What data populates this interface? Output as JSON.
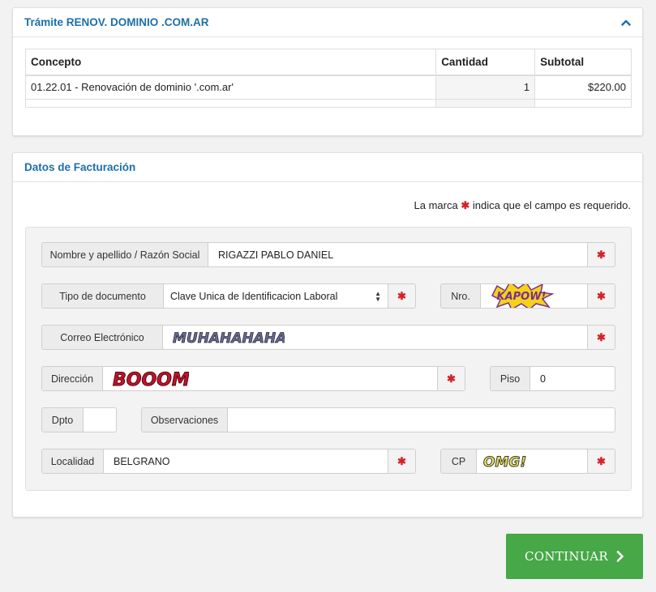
{
  "tramite": {
    "title": "Trámite RENOV. DOMINIO .COM.AR",
    "table": {
      "headers": [
        "Concepto",
        "Cantidad",
        "Subtotal"
      ],
      "rows": [
        {
          "concepto": "01.22.01 - Renovación de dominio '.com.ar'",
          "cantidad": "1",
          "subtotal": "$220.00"
        }
      ]
    }
  },
  "facturacion": {
    "title": "Datos de Facturación",
    "required_note_pre": "La marca",
    "required_note_post": "indica que el campo es requerido.",
    "required_mark": "✱",
    "fields": {
      "nombre": {
        "label": "Nombre y apellido / Razón Social",
        "value": "RIGAZZI PABLO DANIEL"
      },
      "tipo_doc": {
        "label": "Tipo de documento",
        "value": "Clave Unica de Identificacion Laboral"
      },
      "nro": {
        "label": "Nro.",
        "value": ""
      },
      "correo": {
        "label": "Correo Electrónico",
        "value": ""
      },
      "direccion": {
        "label": "Dirección",
        "value": ""
      },
      "piso": {
        "label": "Piso",
        "value": "0"
      },
      "dpto": {
        "label": "Dpto",
        "value": ""
      },
      "observaciones": {
        "label": "Observaciones",
        "value": ""
      },
      "localidad": {
        "label": "Localidad",
        "value": "BELGRANO"
      },
      "cp": {
        "label": "CP",
        "value": ""
      }
    },
    "stickers": {
      "nro": "KAPOW!",
      "correo": "MUHAHAHAHA",
      "direccion": "BOOOM",
      "cp": "OMG!"
    }
  },
  "actions": {
    "continue_label": "CONTINUAR"
  },
  "colors": {
    "accent": "#1c6fa8",
    "required": "#d2232a",
    "continue": "#46a846"
  }
}
